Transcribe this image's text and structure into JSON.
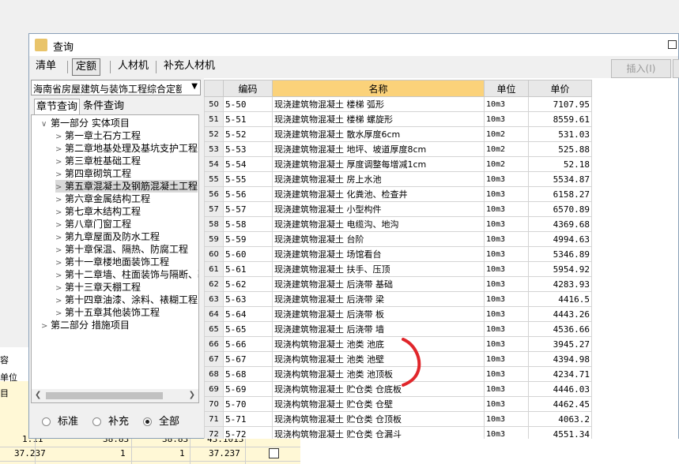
{
  "window": {
    "title": "查询"
  },
  "main_tabs": [
    "清单",
    "定额",
    "人材机",
    "补充人材机"
  ],
  "insert_label": "插入(I)",
  "combo_value": "海南省房屋建筑与装饰工程综合定额",
  "sub_tabs": [
    "章节查询",
    "条件查询"
  ],
  "tree": [
    {
      "label": "第一部分 实体项目",
      "level": 0,
      "arrow": "open"
    },
    {
      "label": "第一章土石方工程",
      "level": 1,
      "arrow": "closed"
    },
    {
      "label": "第二章地基处理及基坑支护工程",
      "level": 1,
      "arrow": "closed"
    },
    {
      "label": "第三章桩基础工程",
      "level": 1,
      "arrow": "closed"
    },
    {
      "label": "第四章砌筑工程",
      "level": 1,
      "arrow": "closed"
    },
    {
      "label": "第五章混凝土及钢筋混凝土工程",
      "level": 1,
      "arrow": "closed",
      "selected": true
    },
    {
      "label": "第六章金属结构工程",
      "level": 1,
      "arrow": "closed"
    },
    {
      "label": "第七章木结构工程",
      "level": 1,
      "arrow": "closed"
    },
    {
      "label": "第八章门窗工程",
      "level": 1,
      "arrow": "closed"
    },
    {
      "label": "第九章屋面及防水工程",
      "level": 1,
      "arrow": "closed"
    },
    {
      "label": "第十章保温、隔热、防腐工程",
      "level": 1,
      "arrow": "closed"
    },
    {
      "label": "第十一章楼地面装饰工程",
      "level": 1,
      "arrow": "closed"
    },
    {
      "label": "第十二章墙、柱面装饰与隔断、幕墙",
      "level": 1,
      "arrow": "closed"
    },
    {
      "label": "第十三章天棚工程",
      "level": 1,
      "arrow": "closed"
    },
    {
      "label": "第十四章油漆、涂料、裱糊工程",
      "level": 1,
      "arrow": "closed"
    },
    {
      "label": "第十五章其他装饰工程",
      "level": 1,
      "arrow": "closed"
    },
    {
      "label": "第二部分 措施项目",
      "level": 0,
      "arrow": "closed"
    }
  ],
  "radios": [
    {
      "label": "标准",
      "checked": false
    },
    {
      "label": "补充",
      "checked": false
    },
    {
      "label": "全部",
      "checked": true
    }
  ],
  "columns": [
    "编码",
    "名称",
    "单位",
    "单价"
  ],
  "rows": [
    {
      "n": "50",
      "code": "5-50",
      "name": "现浇建筑物混凝土 楼梯 弧形",
      "unit": "10m3",
      "price": "7107.95"
    },
    {
      "n": "51",
      "code": "5-51",
      "name": "现浇建筑物混凝土 楼梯 螺旋形",
      "unit": "10m3",
      "price": "8559.61"
    },
    {
      "n": "52",
      "code": "5-52",
      "name": "现浇建筑物混凝土 散水厚度6cm",
      "unit": "10m2",
      "price": "531.03"
    },
    {
      "n": "53",
      "code": "5-53",
      "name": "现浇建筑物混凝土 地坪、坡道厚度8cm",
      "unit": "10m2",
      "price": "525.88"
    },
    {
      "n": "54",
      "code": "5-54",
      "name": "现浇建筑物混凝土 厚度调整每增减1cm",
      "unit": "10m2",
      "price": "52.18"
    },
    {
      "n": "55",
      "code": "5-55",
      "name": "现浇建筑物混凝土 房上水池",
      "unit": "10m3",
      "price": "5534.87"
    },
    {
      "n": "56",
      "code": "5-56",
      "name": "现浇建筑物混凝土 化粪池、检查井",
      "unit": "10m3",
      "price": "6158.27"
    },
    {
      "n": "57",
      "code": "5-57",
      "name": "现浇建筑物混凝土 小型构件",
      "unit": "10m3",
      "price": "6570.89"
    },
    {
      "n": "58",
      "code": "5-58",
      "name": "现浇建筑物混凝土 电缆沟、地沟",
      "unit": "10m3",
      "price": "4369.68"
    },
    {
      "n": "59",
      "code": "5-59",
      "name": "现浇建筑物混凝土 台阶",
      "unit": "10m3",
      "price": "4994.63"
    },
    {
      "n": "60",
      "code": "5-60",
      "name": "现浇建筑物混凝土 场馆看台",
      "unit": "10m3",
      "price": "5346.89"
    },
    {
      "n": "61",
      "code": "5-61",
      "name": "现浇建筑物混凝土 扶手、压顶",
      "unit": "10m3",
      "price": "5954.92"
    },
    {
      "n": "62",
      "code": "5-62",
      "name": "现浇建筑物混凝土 后浇带 基础",
      "unit": "10m3",
      "price": "4283.93"
    },
    {
      "n": "63",
      "code": "5-63",
      "name": "现浇建筑物混凝土 后浇带 梁",
      "unit": "10m3",
      "price": "4416.5"
    },
    {
      "n": "64",
      "code": "5-64",
      "name": "现浇建筑物混凝土 后浇带 板",
      "unit": "10m3",
      "price": "4443.26"
    },
    {
      "n": "65",
      "code": "5-65",
      "name": "现浇建筑物混凝土 后浇带 墙",
      "unit": "10m3",
      "price": "4536.66"
    },
    {
      "n": "66",
      "code": "5-66",
      "name": "现浇构筑物混凝土 池类 池底",
      "unit": "10m3",
      "price": "3945.27"
    },
    {
      "n": "67",
      "code": "5-67",
      "name": "现浇构筑物混凝土 池类 池壁",
      "unit": "10m3",
      "price": "4394.98"
    },
    {
      "n": "68",
      "code": "5-68",
      "name": "现浇构筑物混凝土 池类 池顶板",
      "unit": "10m3",
      "price": "4234.71"
    },
    {
      "n": "69",
      "code": "5-69",
      "name": "现浇构筑物混凝土 贮仓类 仓底板",
      "unit": "10m3",
      "price": "4446.03"
    },
    {
      "n": "70",
      "code": "5-70",
      "name": "现浇构筑物混凝土 贮仓类 仓壁",
      "unit": "10m3",
      "price": "4462.45"
    },
    {
      "n": "71",
      "code": "5-71",
      "name": "现浇构筑物混凝土 贮仓类 仓顶板",
      "unit": "10m3",
      "price": "4063.2"
    },
    {
      "n": "72",
      "code": "5-72",
      "name": "现浇构筑物混凝土 贮仓类 仓漏斗",
      "unit": "10m3",
      "price": "4551.34"
    }
  ],
  "background": {
    "label_rong": "容",
    "label_danwei": "单位",
    "label_mu": "目",
    "row1": [
      "1.11",
      "38.83",
      "38.83",
      "43.1013"
    ],
    "row2": [
      "37.237",
      "1",
      "1",
      "37.237"
    ]
  },
  "colors": {
    "name_header": "#fbd27a",
    "annotation": "#e0262b",
    "bg_grid": "#fff8d6"
  }
}
